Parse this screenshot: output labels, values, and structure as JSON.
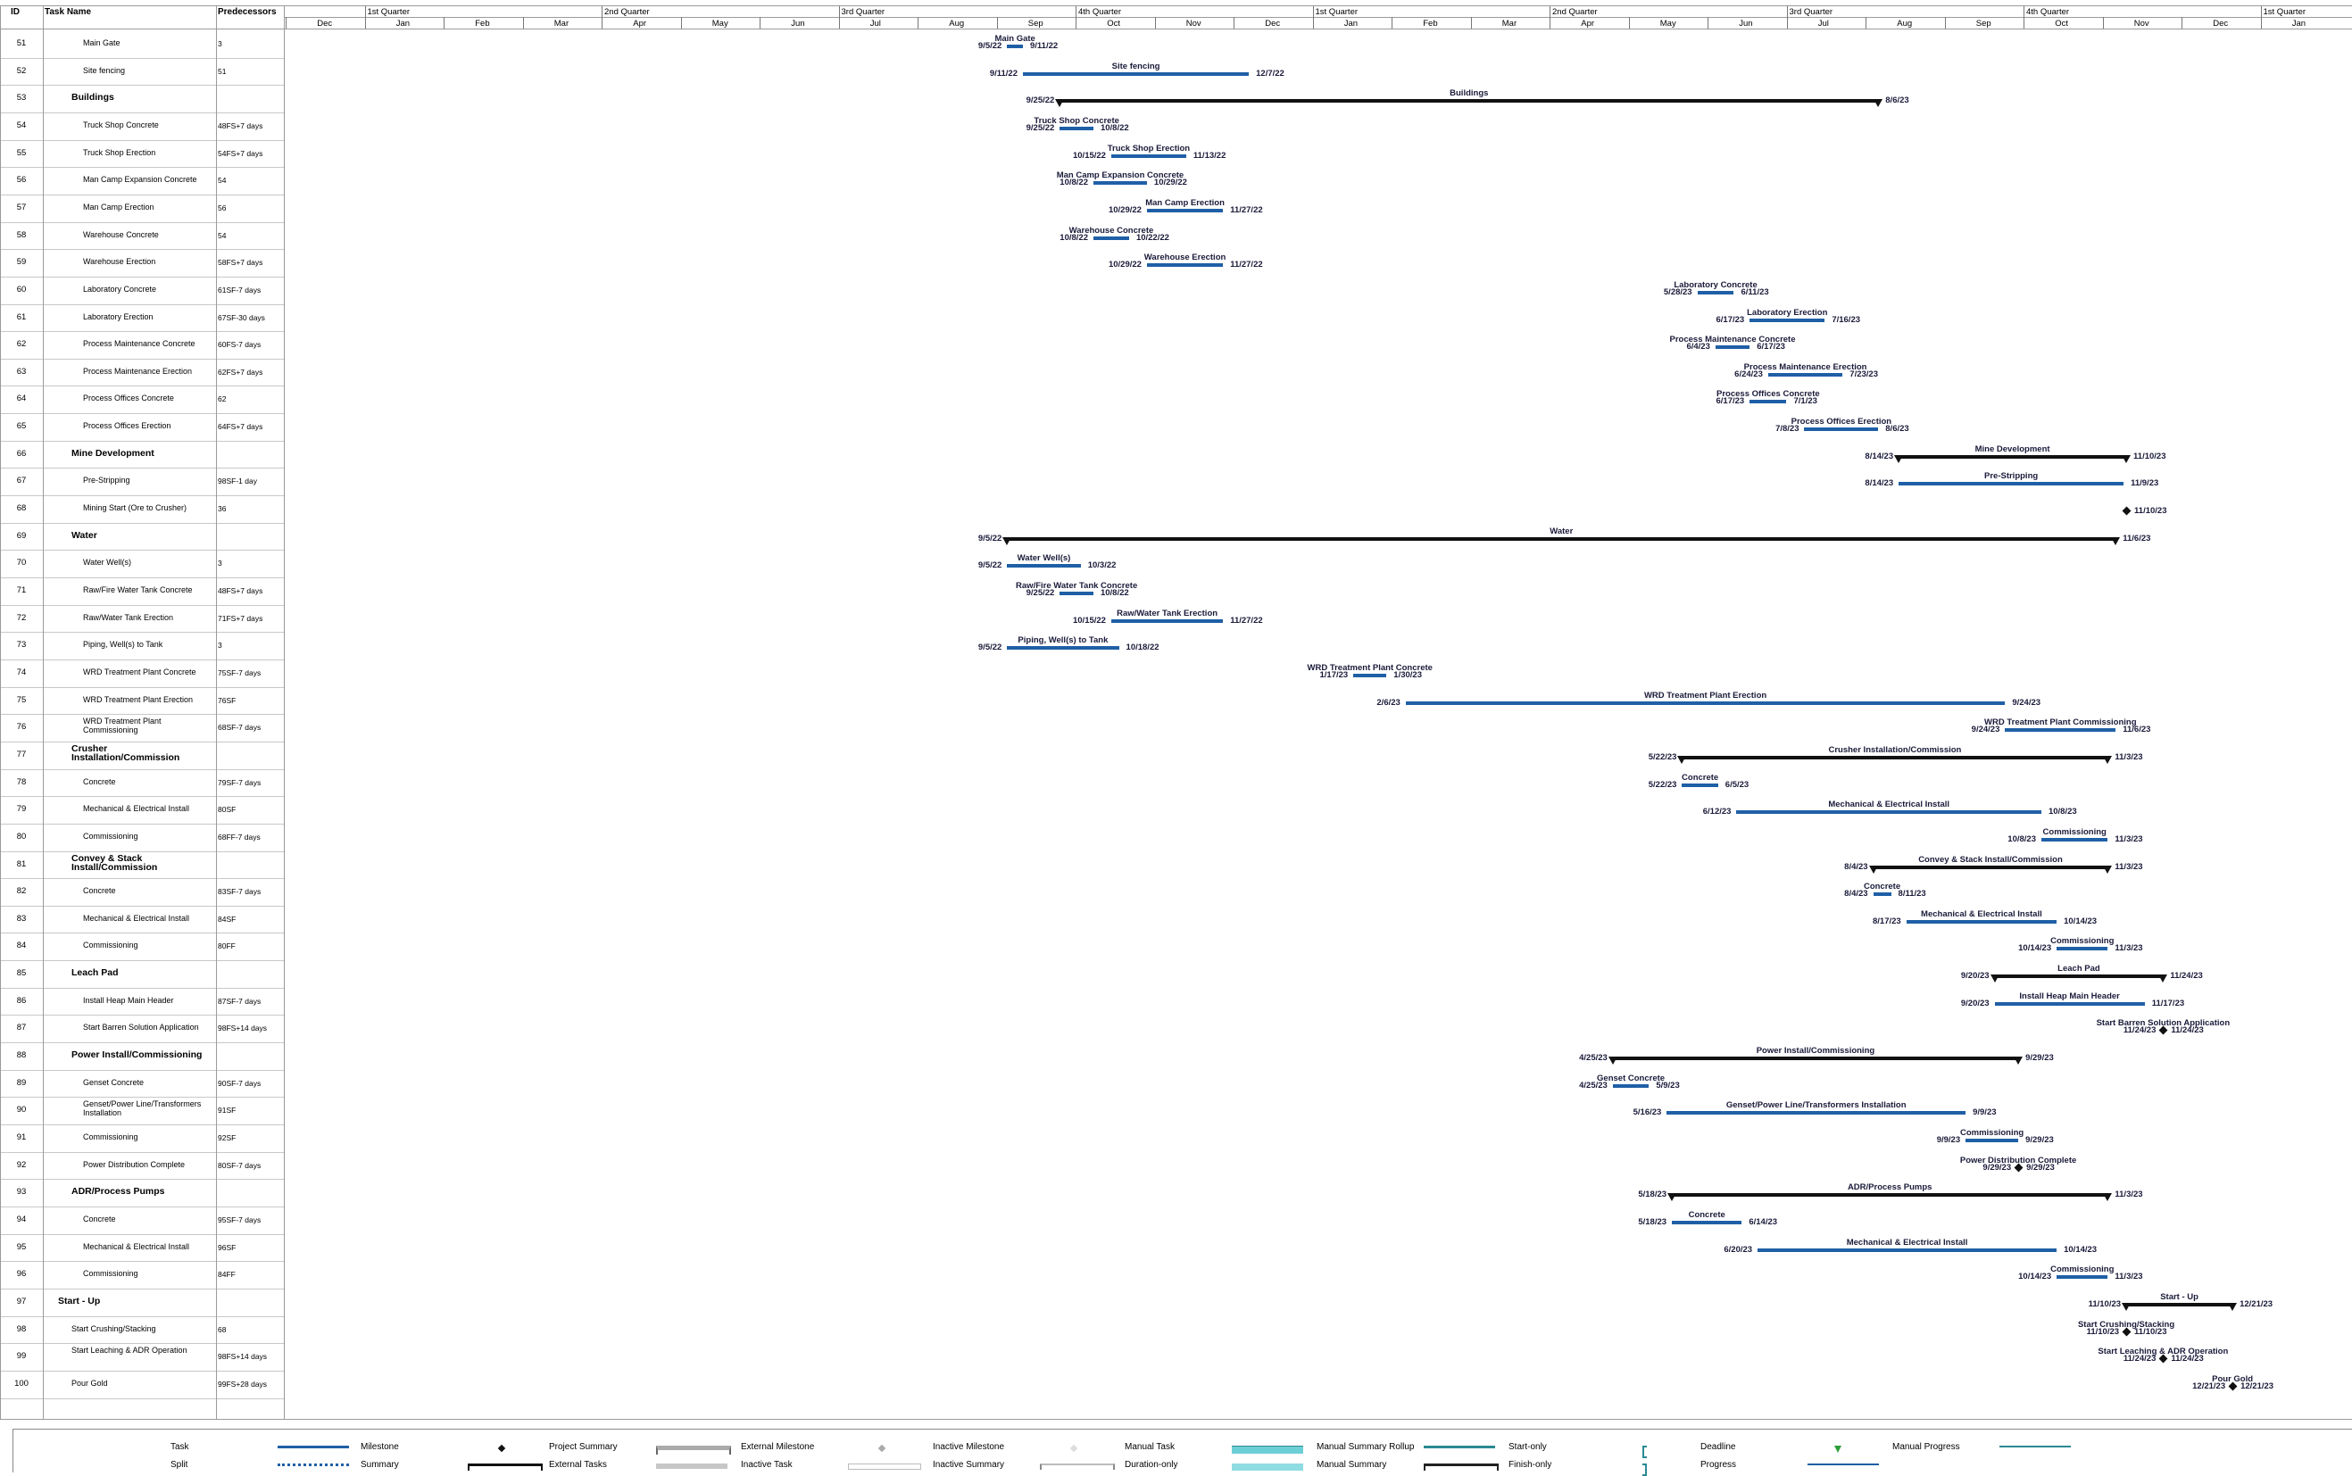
{
  "table": {
    "headers": {
      "id": "ID",
      "name": "Task Name",
      "pred": "Predecessors"
    }
  },
  "timescale": {
    "quarters": [
      {
        "label": "1st Quarter",
        "year_offset": 0
      },
      {
        "label": "2nd Quarter",
        "year_offset": 0
      },
      {
        "label": "3rd Quarter",
        "year_offset": 0
      },
      {
        "label": "4th Quarter",
        "year_offset": 0
      },
      {
        "label": "1st Quarter",
        "year_offset": 1
      },
      {
        "label": "2nd Quarter",
        "year_offset": 1
      },
      {
        "label": "3rd Quarter",
        "year_offset": 1
      },
      {
        "label": "4th Quarter",
        "year_offset": 1
      },
      {
        "label": "1st Quarter",
        "year_offset": 2
      }
    ],
    "months": [
      "Dec",
      "Jan",
      "Feb",
      "Mar",
      "Apr",
      "May",
      "Jun",
      "Jul",
      "Aug",
      "Sep",
      "Oct",
      "Nov",
      "Dec",
      "Jan",
      "Feb",
      "Mar",
      "Apr",
      "May",
      "Jun",
      "Jul",
      "Aug",
      "Sep",
      "Oct",
      "Nov",
      "Dec",
      "Jan"
    ]
  },
  "rows": [
    {
      "id": "51",
      "name": "Main Gate",
      "pred": "3",
      "level": 2,
      "summary": false
    },
    {
      "id": "52",
      "name": "Site fencing",
      "pred": "51",
      "level": 2,
      "summary": false
    },
    {
      "id": "53",
      "name": "Buildings",
      "pred": "",
      "level": 1,
      "summary": true
    },
    {
      "id": "54",
      "name": "Truck Shop Concrete",
      "pred": "48FS+7 days",
      "level": 2,
      "summary": false
    },
    {
      "id": "55",
      "name": "Truck Shop Erection",
      "pred": "54FS+7 days",
      "level": 2,
      "summary": false
    },
    {
      "id": "56",
      "name": "Man Camp Expansion Concrete",
      "pred": "54",
      "level": 2,
      "summary": false
    },
    {
      "id": "57",
      "name": "Man Camp Erection",
      "pred": "56",
      "level": 2,
      "summary": false
    },
    {
      "id": "58",
      "name": "Warehouse Concrete",
      "pred": "54",
      "level": 2,
      "summary": false
    },
    {
      "id": "59",
      "name": "Warehouse Erection",
      "pred": "58FS+7 days",
      "level": 2,
      "summary": false
    },
    {
      "id": "60",
      "name": "Laboratory Concrete",
      "pred": "61SF-7 days",
      "level": 2,
      "summary": false
    },
    {
      "id": "61",
      "name": "Laboratory Erection",
      "pred": "67SF-30 days",
      "level": 2,
      "summary": false
    },
    {
      "id": "62",
      "name": "Process Maintenance Concrete",
      "pred": "60FS-7 days",
      "level": 2,
      "summary": false
    },
    {
      "id": "63",
      "name": "Process Maintenance Erection",
      "pred": "62FS+7 days",
      "level": 2,
      "summary": false
    },
    {
      "id": "64",
      "name": "Process Offices Concrete",
      "pred": "62",
      "level": 2,
      "summary": false
    },
    {
      "id": "65",
      "name": "Process Offices Erection",
      "pred": "64FS+7 days",
      "level": 2,
      "summary": false
    },
    {
      "id": "66",
      "name": "Mine Development",
      "pred": "",
      "level": 1,
      "summary": true
    },
    {
      "id": "67",
      "name": "Pre-Stripping",
      "pred": "98SF-1 day",
      "level": 2,
      "summary": false
    },
    {
      "id": "68",
      "name": "Mining Start (Ore to Crusher)",
      "pred": "36",
      "level": 2,
      "summary": false
    },
    {
      "id": "69",
      "name": "Water",
      "pred": "",
      "level": 1,
      "summary": true
    },
    {
      "id": "70",
      "name": "Water Well(s)",
      "pred": "3",
      "level": 2,
      "summary": false
    },
    {
      "id": "71",
      "name": "Raw/Fire Water Tank Concrete",
      "pred": "48FS+7 days",
      "level": 2,
      "summary": false
    },
    {
      "id": "72",
      "name": "Raw/Water Tank Erection",
      "pred": "71FS+7 days",
      "level": 2,
      "summary": false
    },
    {
      "id": "73",
      "name": "Piping, Well(s) to Tank",
      "pred": "3",
      "level": 2,
      "summary": false
    },
    {
      "id": "74",
      "name": "WRD Treatment Plant Concrete",
      "pred": "75SF-7 days",
      "level": 2,
      "summary": false
    },
    {
      "id": "75",
      "name": "WRD Treatment Plant Erection",
      "pred": "76SF",
      "level": 2,
      "summary": false
    },
    {
      "id": "76",
      "name": "WRD Treatment Plant Commissioning",
      "pred": "68SF-7 days",
      "level": 2,
      "summary": false,
      "wrap": true
    },
    {
      "id": "77",
      "name": "Crusher Installation/Commission",
      "pred": "",
      "level": 1,
      "summary": true,
      "wrap": true
    },
    {
      "id": "78",
      "name": "Concrete",
      "pred": "79SF-7 days",
      "level": 2,
      "summary": false
    },
    {
      "id": "79",
      "name": "Mechanical & Electrical Install",
      "pred": "80SF",
      "level": 2,
      "summary": false
    },
    {
      "id": "80",
      "name": "Commissioning",
      "pred": "68FF-7 days",
      "level": 2,
      "summary": false
    },
    {
      "id": "81",
      "name": "Convey & Stack Install/Commission",
      "pred": "",
      "level": 1,
      "summary": true,
      "wrap": true
    },
    {
      "id": "82",
      "name": "Concrete",
      "pred": "83SF-7 days",
      "level": 2,
      "summary": false
    },
    {
      "id": "83",
      "name": "Mechanical & Electrical Install",
      "pred": "84SF",
      "level": 2,
      "summary": false
    },
    {
      "id": "84",
      "name": "Commissioning",
      "pred": "80FF",
      "level": 2,
      "summary": false
    },
    {
      "id": "85",
      "name": "Leach Pad",
      "pred": "",
      "level": 1,
      "summary": true
    },
    {
      "id": "86",
      "name": "Install Heap Main Header",
      "pred": "87SF-7 days",
      "level": 2,
      "summary": false
    },
    {
      "id": "87",
      "name": "Start Barren Solution Application",
      "pred": "98FS+14 days",
      "level": 2,
      "summary": false
    },
    {
      "id": "88",
      "name": "Power Install/Commissioning",
      "pred": "",
      "level": 1,
      "summary": true
    },
    {
      "id": "89",
      "name": "Genset Concrete",
      "pred": "90SF-7 days",
      "level": 2,
      "summary": false
    },
    {
      "id": "90",
      "name": "Genset/Power Line/Transformers Installation",
      "pred": "91SF",
      "level": 2,
      "summary": false,
      "wrap": true
    },
    {
      "id": "91",
      "name": "Commissioning",
      "pred": "92SF",
      "level": 2,
      "summary": false
    },
    {
      "id": "92",
      "name": "Power Distribution Complete",
      "pred": "80SF-7 days",
      "level": 2,
      "summary": false
    },
    {
      "id": "93",
      "name": "ADR/Process Pumps",
      "pred": "",
      "level": 1,
      "summary": true
    },
    {
      "id": "94",
      "name": "Concrete",
      "pred": "95SF-7 days",
      "level": 2,
      "summary": false
    },
    {
      "id": "95",
      "name": "Mechanical & Electrical Install",
      "pred": "96SF",
      "level": 2,
      "summary": false
    },
    {
      "id": "96",
      "name": "Commissioning",
      "pred": "84FF",
      "level": 2,
      "summary": false
    },
    {
      "id": "97",
      "name": "Start - Up",
      "pred": "",
      "level": 0,
      "summary": true
    },
    {
      "id": "98",
      "name": "Start Crushing/Stacking",
      "pred": "68",
      "level": 1,
      "summary": false
    },
    {
      "id": "99",
      "name": "Start Leaching & ADR Operation",
      "pred": "98FS+14 days",
      "level": 1,
      "summary": false,
      "wrap": true
    },
    {
      "id": "100",
      "name": "Pour Gold",
      "pred": "99FS+28 days",
      "level": 1,
      "summary": false
    }
  ],
  "gantt": [
    {
      "row": 0,
      "type": "task",
      "start": "2022-09-05",
      "finish": "2022-09-11",
      "label": "Main Gate",
      "start_label": "9/5/22",
      "finish_label": "9/11/22"
    },
    {
      "row": 1,
      "type": "task",
      "start": "2022-09-11",
      "finish": "2022-12-07",
      "label": "Site fencing",
      "start_label": "9/11/22",
      "finish_label": "12/7/22"
    },
    {
      "row": 2,
      "type": "summary",
      "start": "2022-09-25",
      "finish": "2023-08-06",
      "label": "Buildings",
      "start_label": "9/25/22",
      "finish_label": "8/6/23"
    },
    {
      "row": 3,
      "type": "task",
      "start": "2022-09-25",
      "finish": "2022-10-08",
      "label": "Truck Shop Concrete",
      "start_label": "9/25/22",
      "finish_label": "10/8/22"
    },
    {
      "row": 4,
      "type": "task",
      "start": "2022-10-15",
      "finish": "2022-11-13",
      "label": "Truck Shop Erection",
      "start_label": "10/15/22",
      "finish_label": "11/13/22"
    },
    {
      "row": 5,
      "type": "task",
      "start": "2022-10-08",
      "finish": "2022-10-29",
      "label": "Man Camp Expansion Concrete",
      "start_label": "10/8/22",
      "finish_label": "10/29/22"
    },
    {
      "row": 6,
      "type": "task",
      "start": "2022-10-29",
      "finish": "2022-11-27",
      "label": "Man Camp Erection",
      "start_label": "10/29/22",
      "finish_label": "11/27/22"
    },
    {
      "row": 7,
      "type": "task",
      "start": "2022-10-08",
      "finish": "2022-10-22",
      "label": "Warehouse Concrete",
      "start_label": "10/8/22",
      "finish_label": "10/22/22"
    },
    {
      "row": 8,
      "type": "task",
      "start": "2022-10-29",
      "finish": "2022-11-27",
      "label": "Warehouse Erection",
      "start_label": "10/29/22",
      "finish_label": "11/27/22"
    },
    {
      "row": 9,
      "type": "task",
      "start": "2023-05-28",
      "finish": "2023-06-11",
      "label": "Laboratory Concrete",
      "start_label": "5/28/23",
      "finish_label": "6/11/23"
    },
    {
      "row": 10,
      "type": "task",
      "start": "2023-06-17",
      "finish": "2023-07-16",
      "label": "Laboratory Erection",
      "start_label": "6/17/23",
      "finish_label": "7/16/23"
    },
    {
      "row": 11,
      "type": "task",
      "start": "2023-06-04",
      "finish": "2023-06-17",
      "label": "Process Maintenance Concrete",
      "start_label": "6/4/23",
      "finish_label": "6/17/23"
    },
    {
      "row": 12,
      "type": "task",
      "start": "2023-06-24",
      "finish": "2023-07-23",
      "label": "Process Maintenance Erection",
      "start_label": "6/24/23",
      "finish_label": "7/23/23"
    },
    {
      "row": 13,
      "type": "task",
      "start": "2023-06-17",
      "finish": "2023-07-01",
      "label": "Process Offices Concrete",
      "start_label": "6/17/23",
      "finish_label": "7/1/23"
    },
    {
      "row": 14,
      "type": "task",
      "start": "2023-07-08",
      "finish": "2023-08-06",
      "label": "Process Offices Erection",
      "start_label": "7/8/23",
      "finish_label": "8/6/23"
    },
    {
      "row": 15,
      "type": "summary",
      "start": "2023-08-14",
      "finish": "2023-11-10",
      "label": "Mine Development",
      "start_label": "8/14/23",
      "finish_label": "11/10/23"
    },
    {
      "row": 16,
      "type": "task",
      "start": "2023-08-14",
      "finish": "2023-11-09",
      "label": "Pre-Stripping",
      "start_label": "8/14/23",
      "finish_label": "11/9/23"
    },
    {
      "row": 17,
      "type": "milestone",
      "start": "2023-11-10",
      "finish": "2023-11-10",
      "label": "",
      "start_label": "",
      "finish_label": "11/10/23"
    },
    {
      "row": 18,
      "type": "summary",
      "start": "2022-09-05",
      "finish": "2023-11-06",
      "label": "Water",
      "start_label": "9/5/22",
      "finish_label": "11/6/23"
    },
    {
      "row": 19,
      "type": "task",
      "start": "2022-09-05",
      "finish": "2022-10-03",
      "label": "Water Well(s)",
      "start_label": "9/5/22",
      "finish_label": "10/3/22"
    },
    {
      "row": 20,
      "type": "task",
      "start": "2022-09-25",
      "finish": "2022-10-08",
      "label": "Raw/Fire Water Tank Concrete",
      "start_label": "9/25/22",
      "finish_label": "10/8/22"
    },
    {
      "row": 21,
      "type": "task",
      "start": "2022-10-15",
      "finish": "2022-11-27",
      "label": "Raw/Water Tank Erection",
      "start_label": "10/15/22",
      "finish_label": "11/27/22"
    },
    {
      "row": 22,
      "type": "task",
      "start": "2022-09-05",
      "finish": "2022-10-18",
      "label": "Piping, Well(s) to Tank",
      "start_label": "9/5/22",
      "finish_label": "10/18/22"
    },
    {
      "row": 23,
      "type": "task",
      "start": "2023-01-17",
      "finish": "2023-01-30",
      "label": "WRD Treatment Plant Concrete",
      "start_label": "1/17/23",
      "finish_label": "1/30/23"
    },
    {
      "row": 24,
      "type": "task",
      "start": "2023-02-06",
      "finish": "2023-09-24",
      "label": "WRD Treatment Plant Erection",
      "start_label": "2/6/23",
      "finish_label": "9/24/23"
    },
    {
      "row": 25,
      "type": "task",
      "start": "2023-09-24",
      "finish": "2023-11-06",
      "label": "WRD Treatment Plant Commissioning",
      "start_label": "9/24/23",
      "finish_label": "11/6/23"
    },
    {
      "row": 26,
      "type": "summary",
      "start": "2023-05-22",
      "finish": "2023-11-03",
      "label": "Crusher Installation/Commission",
      "start_label": "5/22/23",
      "finish_label": "11/3/23"
    },
    {
      "row": 27,
      "type": "task",
      "start": "2023-05-22",
      "finish": "2023-06-05",
      "label": "Concrete",
      "start_label": "5/22/23",
      "finish_label": "6/5/23"
    },
    {
      "row": 28,
      "type": "task",
      "start": "2023-06-12",
      "finish": "2023-10-08",
      "label": "Mechanical & Electrical Install",
      "start_label": "6/12/23",
      "finish_label": "10/8/23"
    },
    {
      "row": 29,
      "type": "task",
      "start": "2023-10-08",
      "finish": "2023-11-03",
      "label": "Commissioning",
      "start_label": "10/8/23",
      "finish_label": "11/3/23"
    },
    {
      "row": 30,
      "type": "summary",
      "start": "2023-08-04",
      "finish": "2023-11-03",
      "label": "Convey & Stack Install/Commission",
      "start_label": "8/4/23",
      "finish_label": "11/3/23"
    },
    {
      "row": 31,
      "type": "task",
      "start": "2023-08-04",
      "finish": "2023-08-11",
      "label": "Concrete",
      "start_label": "8/4/23",
      "finish_label": "8/11/23"
    },
    {
      "row": 32,
      "type": "task",
      "start": "2023-08-17",
      "finish": "2023-10-14",
      "label": "Mechanical & Electrical Install",
      "start_label": "8/17/23",
      "finish_label": "10/14/23"
    },
    {
      "row": 33,
      "type": "task",
      "start": "2023-10-14",
      "finish": "2023-11-03",
      "label": "Commissioning",
      "start_label": "10/14/23",
      "finish_label": "11/3/23"
    },
    {
      "row": 34,
      "type": "summary",
      "start": "2023-09-20",
      "finish": "2023-11-24",
      "label": "Leach Pad",
      "start_label": "9/20/23",
      "finish_label": "11/24/23"
    },
    {
      "row": 35,
      "type": "task",
      "start": "2023-09-20",
      "finish": "2023-11-17",
      "label": "Install Heap Main Header",
      "start_label": "9/20/23",
      "finish_label": "11/17/23"
    },
    {
      "row": 36,
      "type": "milestone",
      "start": "2023-11-24",
      "finish": "2023-11-24",
      "label": "Start Barren Solution Application",
      "start_label": "11/24/23",
      "finish_label": "11/24/23"
    },
    {
      "row": 37,
      "type": "summary",
      "start": "2023-04-25",
      "finish": "2023-09-29",
      "label": "Power Install/Commissioning",
      "start_label": "4/25/23",
      "finish_label": "9/29/23"
    },
    {
      "row": 38,
      "type": "task",
      "start": "2023-04-25",
      "finish": "2023-05-09",
      "label": "Genset Concrete",
      "start_label": "4/25/23",
      "finish_label": "5/9/23"
    },
    {
      "row": 39,
      "type": "task",
      "start": "2023-05-16",
      "finish": "2023-09-09",
      "label": "Genset/Power Line/Transformers Installation",
      "start_label": "5/16/23",
      "finish_label": "9/9/23"
    },
    {
      "row": 40,
      "type": "task",
      "start": "2023-09-09",
      "finish": "2023-09-29",
      "label": "Commissioning",
      "start_label": "9/9/23",
      "finish_label": "9/29/23"
    },
    {
      "row": 41,
      "type": "milestone",
      "start": "2023-09-29",
      "finish": "2023-09-29",
      "label": "Power Distribution Complete",
      "start_label": "9/29/23",
      "finish_label": "9/29/23"
    },
    {
      "row": 42,
      "type": "summary",
      "start": "2023-05-18",
      "finish": "2023-11-03",
      "label": "ADR/Process Pumps",
      "start_label": "5/18/23",
      "finish_label": "11/3/23"
    },
    {
      "row": 43,
      "type": "task",
      "start": "2023-05-18",
      "finish": "2023-06-14",
      "label": "Concrete",
      "start_label": "5/18/23",
      "finish_label": "6/14/23"
    },
    {
      "row": 44,
      "type": "task",
      "start": "2023-06-20",
      "finish": "2023-10-14",
      "label": "Mechanical & Electrical Install",
      "start_label": "6/20/23",
      "finish_label": "10/14/23"
    },
    {
      "row": 45,
      "type": "task",
      "start": "2023-10-14",
      "finish": "2023-11-03",
      "label": "Commissioning",
      "start_label": "10/14/23",
      "finish_label": "11/3/23"
    },
    {
      "row": 46,
      "type": "summary",
      "start": "2023-11-10",
      "finish": "2023-12-21",
      "label": "Start - Up",
      "start_label": "11/10/23",
      "finish_label": "12/21/23"
    },
    {
      "row": 47,
      "type": "milestone",
      "start": "2023-11-10",
      "finish": "2023-11-10",
      "label": "Start Crushing/Stacking",
      "start_label": "11/10/23",
      "finish_label": "11/10/23"
    },
    {
      "row": 48,
      "type": "milestone",
      "start": "2023-11-24",
      "finish": "2023-11-24",
      "label": "Start Leaching & ADR Operation",
      "start_label": "11/24/23",
      "finish_label": "11/24/23"
    },
    {
      "row": 49,
      "type": "milestone",
      "start": "2023-12-21",
      "finish": "2023-12-21",
      "label": "Pour Gold",
      "start_label": "12/21/23",
      "finish_label": "12/21/23"
    }
  ],
  "legend": {
    "col1": [
      "Task",
      "Split"
    ],
    "col2": [
      "Milestone",
      "Summary"
    ],
    "col3": [
      "Project Summary",
      "External Tasks"
    ],
    "col4": [
      "External Milestone",
      "Inactive Task"
    ],
    "col5": [
      "Inactive Milestone",
      "Inactive Summary"
    ],
    "col6": [
      "Manual Task",
      "Duration-only"
    ],
    "col7": [
      "Manual Summary Rollup",
      "Manual Summary"
    ],
    "col8": [
      "Start-only",
      "Finish-only"
    ],
    "col9": [
      "Deadline",
      "Progress"
    ],
    "col10": [
      "Manual Progress"
    ]
  },
  "colors": {
    "task": "#1f5fa6",
    "summary": "#111111",
    "manual": "#6ccfd6",
    "deadline": "#2e9e3a"
  }
}
